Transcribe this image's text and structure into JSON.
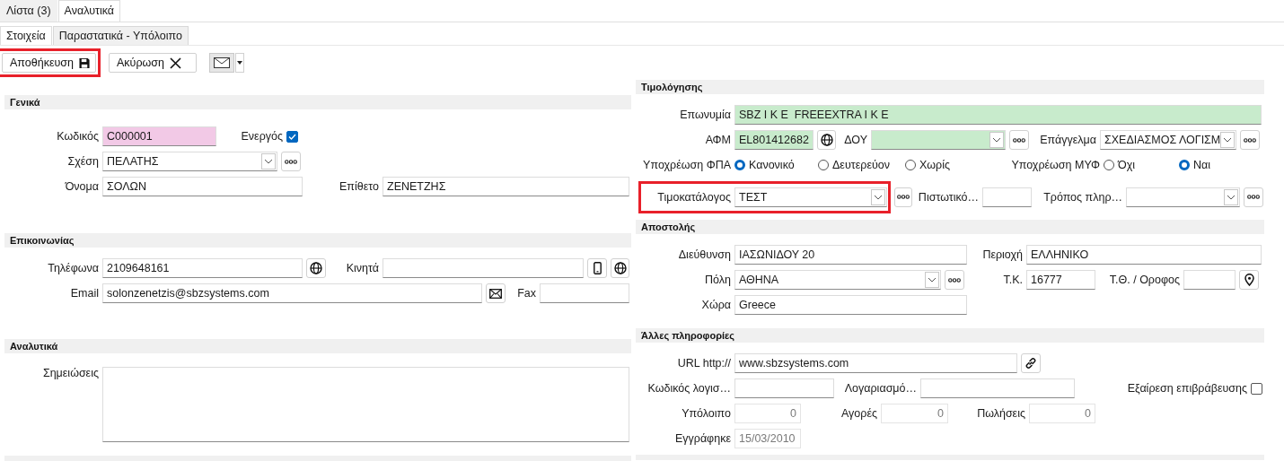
{
  "tabs": [
    {
      "label": "Λίστα (3)",
      "selected": false
    },
    {
      "label": "Αναλυτικά",
      "selected": true
    }
  ],
  "subtabs": [
    {
      "label": "Στοιχεία",
      "selected": true
    },
    {
      "label": "Παραστατικά - Υπόλοιπο",
      "selected": false
    }
  ],
  "toolbar": {
    "buttons": [
      {
        "kind": "save",
        "label": "Αποθήκευση",
        "highlighted": true
      },
      {
        "kind": "cancel",
        "label": "Ακύρωση"
      },
      {
        "kind": "mail-split"
      }
    ]
  },
  "left_sections": [
    {
      "title": "Γενικά",
      "rows": [
        {
          "items": [
            {
              "kind": "label",
              "text": "Κωδικός"
            },
            {
              "kind": "text",
              "value": "C000001",
              "color": "#f2c9e6"
            },
            {
              "kind": "label",
              "text": "Ενεργός"
            },
            {
              "kind": "checkbox",
              "checked": true
            }
          ]
        },
        {
          "items": [
            {
              "kind": "label",
              "text": "Σχέση"
            },
            {
              "kind": "select",
              "value": "ΠΕΛΑΤΗΣ"
            },
            {
              "kind": "more-button"
            }
          ]
        },
        {
          "items": [
            {
              "kind": "label",
              "text": "Όνομα"
            },
            {
              "kind": "text",
              "value": "ΣΟΛΩΝ"
            },
            {
              "kind": "label",
              "text": "Επίθετο"
            },
            {
              "kind": "text",
              "value": "ΖΕΝΕΤΖΗΣ"
            }
          ]
        }
      ]
    },
    {
      "title": "Επικοινωνίας",
      "rows": [
        {
          "items": [
            {
              "kind": "label",
              "text": "Τηλέφωνα"
            },
            {
              "kind": "text",
              "value": "2109648161"
            },
            {
              "kind": "globe-button"
            },
            {
              "kind": "label",
              "text": "Κινητά"
            },
            {
              "kind": "text"
            },
            {
              "kind": "phone-button"
            },
            {
              "kind": "globe-button"
            }
          ]
        },
        {
          "items": [
            {
              "kind": "label",
              "text": "Email"
            },
            {
              "kind": "text",
              "value": "solonzenetzis@sbzsystems.com"
            },
            {
              "kind": "mail-button"
            },
            {
              "kind": "label",
              "text": "Fax"
            },
            {
              "kind": "text"
            }
          ]
        }
      ]
    },
    {
      "title": "Αναλυτικά",
      "rows": [
        {
          "items": [
            {
              "kind": "label",
              "text": "Σημειώσεις"
            },
            {
              "kind": "textarea"
            }
          ]
        }
      ]
    }
  ],
  "right_sections": [
    {
      "title": "Τιμολόγησης",
      "rows": [
        {
          "items": [
            {
              "kind": "label",
              "text": "Επωνυμία"
            },
            {
              "kind": "text",
              "value": "SBZ I K E  FREEEXTRA I K E",
              "color": "#c8ebcc"
            }
          ]
        },
        {
          "items": [
            {
              "kind": "label",
              "text": "ΑΦΜ"
            },
            {
              "kind": "text",
              "value": "EL801412682",
              "color": "#c8ebcc"
            },
            {
              "kind": "globe-button"
            },
            {
              "kind": "label",
              "text": "ΔΟΥ"
            },
            {
              "kind": "select",
              "color": "#c8ebcc"
            },
            {
              "kind": "more-button"
            },
            {
              "kind": "label",
              "text": "Επάγγελμα"
            },
            {
              "kind": "select",
              "value": "ΣΧΕΔΙΑΣΜΟΣ ΛΟΓΙΣΜ"
            },
            {
              "kind": "more-button"
            }
          ]
        },
        {
          "items": [
            {
              "kind": "label",
              "text": "Υποχρέωση ΦΠΑ"
            },
            {
              "kind": "radio",
              "label": "Κανονικό",
              "selected": true
            },
            {
              "kind": "radio",
              "label": "Δευτερεύον",
              "selected": false
            },
            {
              "kind": "radio",
              "label": "Χωρίς",
              "selected": false
            },
            {
              "kind": "label",
              "text": "Υποχρέωση ΜΥΦ"
            },
            {
              "kind": "radio",
              "label": "Όχι",
              "selected": false
            },
            {
              "kind": "radio",
              "label": "Ναι",
              "selected": true
            }
          ]
        },
        {
          "highlighted": true,
          "items": [
            {
              "kind": "label",
              "text": "Τιμοκατάλογος"
            },
            {
              "kind": "select",
              "value": "ΤΕΣΤ"
            },
            {
              "kind": "more-button"
            },
            {
              "kind": "label",
              "text": "Πιστωτικό…"
            },
            {
              "kind": "text"
            },
            {
              "kind": "label",
              "text": "Τρόπος πληρ…"
            },
            {
              "kind": "select"
            },
            {
              "kind": "more-button"
            }
          ]
        }
      ]
    },
    {
      "title": "Αποστολής",
      "rows": [
        {
          "items": [
            {
              "kind": "label",
              "text": "Διεύθυνση"
            },
            {
              "kind": "text",
              "value": "ΙΑΣΩΝΙΔΟΥ 20"
            },
            {
              "kind": "label",
              "text": "Περιοχή"
            },
            {
              "kind": "text",
              "value": "ΕΛΛΗΝΙΚΟ"
            }
          ]
        },
        {
          "items": [
            {
              "kind": "label",
              "text": "Πόλη"
            },
            {
              "kind": "select",
              "value": "ΑΘΗΝΑ"
            },
            {
              "kind": "more-button"
            },
            {
              "kind": "label",
              "text": "Τ.Κ."
            },
            {
              "kind": "text",
              "value": "16777"
            },
            {
              "kind": "label",
              "text": "Τ.Θ. / Οροφος"
            },
            {
              "kind": "text"
            },
            {
              "kind": "pin-button"
            }
          ]
        },
        {
          "items": [
            {
              "kind": "label",
              "text": "Χώρα"
            },
            {
              "kind": "text",
              "value": "Greece"
            }
          ]
        }
      ]
    },
    {
      "title": "Άλλες πληροφορίες",
      "rows": [
        {
          "items": [
            {
              "kind": "label",
              "text": "URL http://"
            },
            {
              "kind": "text",
              "value": "www.sbzsystems.com"
            },
            {
              "kind": "link-button"
            }
          ]
        },
        {
          "items": [
            {
              "kind": "label",
              "text": "Κωδικός λογισ…"
            },
            {
              "kind": "text"
            },
            {
              "kind": "label",
              "text": "Λογαριασμό…"
            },
            {
              "kind": "text"
            },
            {
              "kind": "label",
              "text": "Εξαίρεση επιβράβευσης"
            },
            {
              "kind": "checkbox",
              "checked": false
            }
          ]
        },
        {
          "items": [
            {
              "kind": "label",
              "text": "Υπόλοιπο"
            },
            {
              "kind": "text",
              "value": "0",
              "disabled": true
            },
            {
              "kind": "label",
              "text": "Αγορές"
            },
            {
              "kind": "text",
              "value": "0",
              "disabled": true
            },
            {
              "kind": "label",
              "text": "Πωλήσεις"
            },
            {
              "kind": "text",
              "value": "0",
              "disabled": true
            }
          ]
        },
        {
          "items": [
            {
              "kind": "label",
              "text": "Εγγράφηκε"
            },
            {
              "kind": "text",
              "value": "15/03/2010",
              "disabled": true
            }
          ]
        }
      ]
    }
  ]
}
